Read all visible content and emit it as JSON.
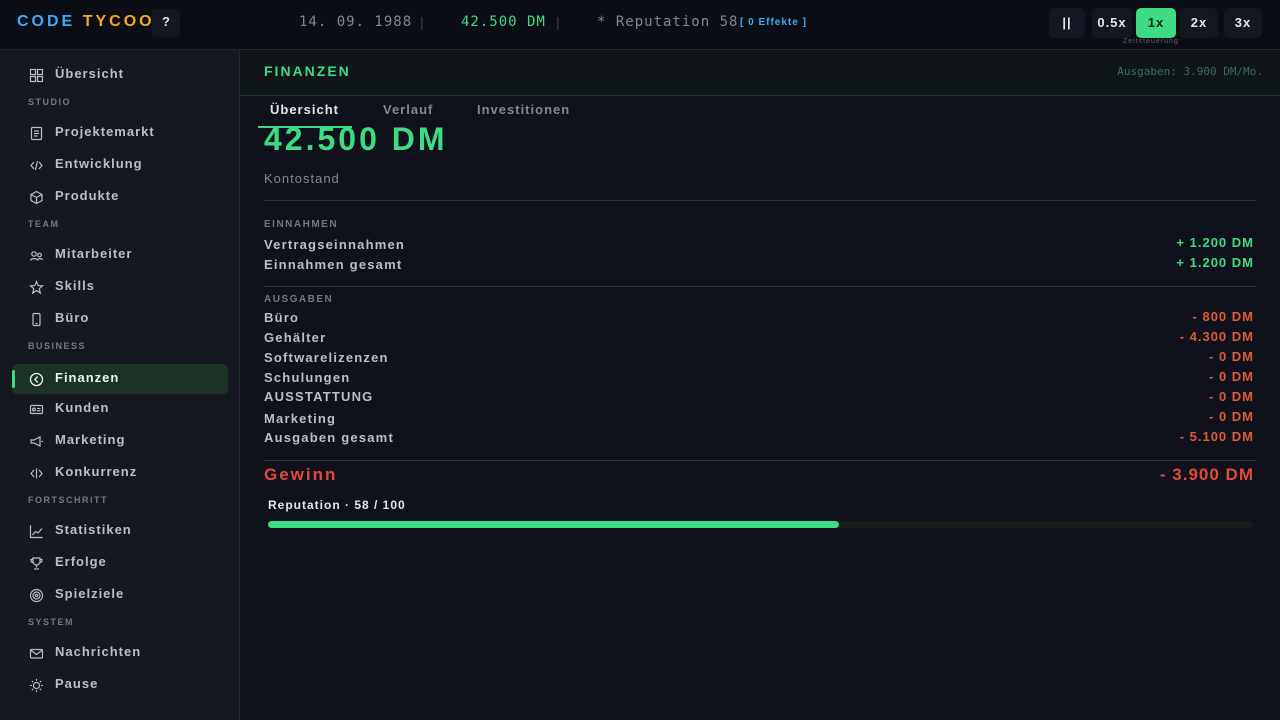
{
  "topbar": {
    "logo_code": "CODE",
    "logo_tycoon": "TYCOON",
    "help_label": "?",
    "date": "14. 09. 1988",
    "separator": "|",
    "money": "42.500 DM",
    "reputation": "* Reputation 58",
    "effects": "[ 0 Effekte ]",
    "pause_label": "||",
    "speeds": [
      "0.5x",
      "1x",
      "2x",
      "3x"
    ],
    "active_speed": "1x",
    "speed_caption": "Zeitsteuerung"
  },
  "sidebar": {
    "overview": "Übersicht",
    "sections": {
      "studio": "STUDIO",
      "team": "TEAM",
      "business": "BUSINESS",
      "progress": "FORTSCHRITT",
      "system": "SYSTEM"
    },
    "items": {
      "projektemarkt": "Projektemarkt",
      "entwicklung": "Entwicklung",
      "produkte": "Produkte",
      "mitarbeiter": "Mitarbeiter",
      "skills": "Skills",
      "buero": "Büro",
      "finanzen": "Finanzen",
      "kunden": "Kunden",
      "marketing": "Marketing",
      "konkurrenz": "Konkurrenz",
      "statistiken": "Statistiken",
      "erfolge": "Erfolge",
      "spielziele": "Spielziele",
      "nachrichten": "Nachrichten",
      "pause": "Pause"
    },
    "active": "finanzen"
  },
  "main": {
    "title": "FINANZEN",
    "expenses_summary": "Ausgaben: 3.900 DM/Mo.",
    "tabs": [
      "Übersicht",
      "Verlauf",
      "Investitionen"
    ],
    "active_tab": "Übersicht",
    "balance": "42.500 DM",
    "balance_label": "Kontostand",
    "income": {
      "heading": "EINNAHMEN",
      "rows": [
        {
          "label": "Vertragseinnahmen",
          "value": "+ 1.200 DM"
        },
        {
          "label": "Einnahmen gesamt",
          "value": "+ 1.200 DM"
        }
      ]
    },
    "expenses": {
      "heading": "AUSGABEN",
      "rows": [
        {
          "label": "Büro",
          "value": "- 800 DM"
        },
        {
          "label": "Gehälter",
          "value": "- 4.300 DM"
        },
        {
          "label": "Softwarelizenzen",
          "value": "- 0 DM"
        },
        {
          "label": "Schulungen",
          "value": "- 0 DM"
        },
        {
          "label": "AUSSTATTUNG",
          "value": "- 0 DM"
        },
        {
          "label": "Marketing",
          "value": "- 0 DM"
        },
        {
          "label": "Ausgaben gesamt",
          "value": "- 5.100 DM"
        }
      ]
    },
    "profit": {
      "label": "Gewinn",
      "value": "- 3.900 DM"
    },
    "reputation": {
      "label": "Reputation  ·  58 / 100",
      "percent": 58
    }
  },
  "colors": {
    "accent": "#3ddc84",
    "negative": "#e05a3a",
    "logo_code": "#3fa9f5",
    "logo_tycoon": "#f5a623"
  }
}
